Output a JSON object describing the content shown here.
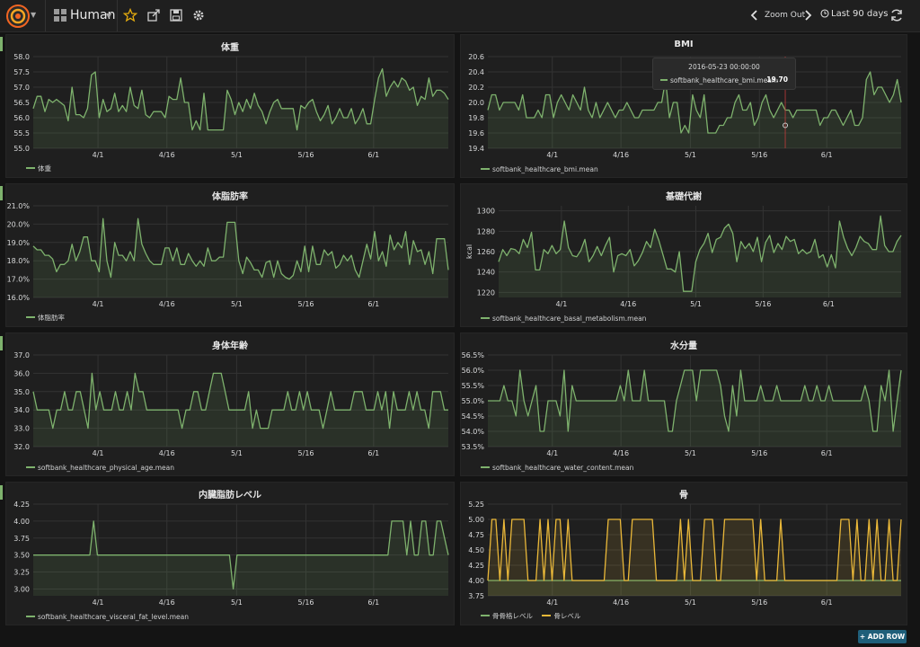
{
  "nav": {
    "dashboard_title": "Human",
    "zoom_out": "Zoom Out",
    "time_range": "Last 90 days",
    "add_row": "+ ADD ROW"
  },
  "tooltip": {
    "time": "2016-05-23 00:00:00",
    "series": "softbank_healthcare_bmi.mean:",
    "value": "19.70"
  },
  "colors": {
    "green": "#7eb26d",
    "yellow": "#eab839",
    "grid": "#333333",
    "axis_text": "#d8d9da"
  },
  "x_ticks": [
    "4/1",
    "4/16",
    "5/1",
    "5/16",
    "6/1"
  ],
  "chart_data": [
    {
      "id": "weight",
      "type": "line",
      "title": "体重",
      "ylabel": "",
      "ylim": [
        55.0,
        58.0
      ],
      "ystep": 0.5,
      "yfmt": 1,
      "ysuffix": "",
      "series": [
        {
          "name": "体重",
          "color": "#7eb26d",
          "values": [
            56.3,
            56.7,
            56.7,
            56.2,
            56.6,
            56.5,
            56.6,
            56.5,
            56.4,
            55.9,
            57.0,
            56.1,
            56.1,
            56.0,
            56.3,
            57.4,
            57.5,
            56.0,
            56.6,
            56.2,
            56.3,
            56.8,
            56.2,
            56.4,
            56.2,
            57.0,
            56.4,
            56.3,
            56.9,
            56.1,
            56.0,
            56.2,
            56.2,
            56.2,
            56.0,
            56.7,
            56.6,
            56.6,
            57.3,
            56.5,
            56.5,
            55.6,
            55.9,
            55.6,
            56.8,
            55.6,
            55.6,
            55.6,
            55.6,
            55.6,
            56.9,
            56.6,
            56.1,
            56.5,
            56.2,
            56.6,
            56.3,
            56.8,
            56.4,
            56.2,
            55.8,
            56.2,
            56.5,
            56.6,
            56.3,
            56.3,
            56.3,
            56.3,
            55.6,
            56.4,
            56.3,
            56.5,
            56.6,
            56.2,
            55.9,
            56.1,
            56.4,
            55.8,
            56.0,
            56.3,
            56.0,
            56.0,
            56.3,
            55.8,
            56.0,
            56.3,
            55.8,
            55.8,
            56.6,
            57.3,
            57.6,
            56.7,
            57.0,
            57.2,
            57.0,
            57.3,
            57.2,
            56.9,
            57.0,
            56.4,
            56.7,
            56.6,
            57.3,
            56.7,
            56.9,
            56.9,
            56.8,
            56.6
          ]
        }
      ]
    },
    {
      "id": "bmi",
      "type": "line",
      "title": "BMI",
      "ylabel": "",
      "ylim": [
        19.4,
        20.6
      ],
      "ystep": 0.2,
      "yfmt": 1,
      "ysuffix": "",
      "series": [
        {
          "name": "softbank_healthcare_bmi.mean",
          "color": "#7eb26d",
          "values": [
            19.9,
            20.1,
            20.1,
            19.9,
            20.0,
            20.0,
            20.0,
            20.0,
            19.9,
            20.1,
            19.8,
            19.8,
            19.8,
            19.9,
            19.8,
            20.1,
            20.1,
            19.8,
            20.0,
            20.1,
            20.0,
            19.9,
            20.1,
            20.0,
            19.9,
            20.2,
            19.9,
            19.8,
            20.0,
            19.8,
            19.9,
            20.0,
            19.9,
            19.8,
            19.9,
            19.9,
            20.0,
            19.9,
            19.8,
            19.8,
            19.9,
            19.9,
            19.9,
            19.9,
            20.0,
            20.0,
            20.3,
            19.8,
            20.0,
            20.0,
            19.6,
            19.7,
            19.6,
            20.1,
            19.9,
            19.8,
            20.1,
            19.6,
            19.6,
            19.6,
            19.7,
            19.7,
            19.8,
            19.8,
            20.0,
            20.1,
            19.9,
            19.9,
            20.0,
            19.7,
            19.8,
            20.0,
            20.1,
            19.9,
            19.8,
            19.9,
            20.0,
            19.9,
            19.9,
            19.8,
            19.9,
            19.9,
            19.9,
            19.9,
            19.9,
            19.9,
            19.7,
            19.8,
            19.8,
            19.9,
            19.9,
            19.8,
            19.7,
            19.8,
            19.9,
            19.7,
            19.7,
            19.8,
            20.3,
            20.4,
            20.1,
            20.2,
            20.2,
            20.1,
            20.0,
            20.1,
            20.3,
            20.0
          ]
        }
      ]
    },
    {
      "id": "fat",
      "type": "line",
      "title": "体脂肪率",
      "ylabel": "",
      "ylim": [
        16.0,
        21.0
      ],
      "ystep": 1.0,
      "yfmt": 1,
      "ysuffix": "%",
      "series": [
        {
          "name": "体脂肪率",
          "color": "#7eb26d",
          "values": [
            18.8,
            18.6,
            18.6,
            18.3,
            18.3,
            18.1,
            17.4,
            17.8,
            17.8,
            18.0,
            18.9,
            18.0,
            18.5,
            19.3,
            19.3,
            18.0,
            18.0,
            17.4,
            20.3,
            18.0,
            17.1,
            19.0,
            18.3,
            18.3,
            18.0,
            18.5,
            18.0,
            20.3,
            18.9,
            18.4,
            18.0,
            17.8,
            17.8,
            17.8,
            18.7,
            18.7,
            18.0,
            18.7,
            17.8,
            17.8,
            18.4,
            18.0,
            17.7,
            18.0,
            17.7,
            18.7,
            18.0,
            18.0,
            18.2,
            18.2,
            20.1,
            20.1,
            20.1,
            18.0,
            17.3,
            18.2,
            17.9,
            17.5,
            17.5,
            17.1,
            17.9,
            18.0,
            17.1,
            18.0,
            17.3,
            17.1,
            17.0,
            17.2,
            18.0,
            17.4,
            18.8,
            17.4,
            18.8,
            17.8,
            17.8,
            18.6,
            18.3,
            18.5,
            17.6,
            17.8,
            18.3,
            18.0,
            18.3,
            17.5,
            17.1,
            18.0,
            18.9,
            18.1,
            19.6,
            18.0,
            18.5,
            17.7,
            19.4,
            18.6,
            19.0,
            18.7,
            19.6,
            17.8,
            19.1,
            18.5,
            18.6,
            17.8,
            18.5,
            17.3,
            19.2,
            19.2,
            19.2,
            17.5
          ]
        }
      ]
    },
    {
      "id": "metabolism",
      "type": "line",
      "title": "基礎代謝",
      "ylabel": "kcal",
      "ylim": [
        1215,
        1305
      ],
      "yticks": [
        1220,
        1240,
        1260,
        1280,
        1300
      ],
      "yfmt": 0,
      "ysuffix": "",
      "series": [
        {
          "name": "softbank_healthcare_basal_metabolism.mean",
          "color": "#7eb26d",
          "values": [
            1250,
            1262,
            1256,
            1263,
            1262,
            1258,
            1272,
            1264,
            1279,
            1242,
            1242,
            1262,
            1258,
            1266,
            1258,
            1262,
            1290,
            1264,
            1256,
            1255,
            1261,
            1272,
            1250,
            1256,
            1265,
            1256,
            1266,
            1274,
            1240,
            1256,
            1258,
            1256,
            1262,
            1246,
            1251,
            1259,
            1270,
            1264,
            1282,
            1271,
            1257,
            1243,
            1243,
            1240,
            1260,
            1221,
            1221,
            1221,
            1250,
            1262,
            1268,
            1278,
            1259,
            1272,
            1274,
            1283,
            1287,
            1278,
            1250,
            1270,
            1263,
            1268,
            1260,
            1274,
            1250,
            1269,
            1276,
            1259,
            1268,
            1262,
            1275,
            1270,
            1272,
            1258,
            1262,
            1258,
            1260,
            1272,
            1254,
            1257,
            1245,
            1257,
            1244,
            1290,
            1274,
            1263,
            1256,
            1264,
            1275,
            1270,
            1268,
            1262,
            1262,
            1295,
            1266,
            1260,
            1260,
            1270,
            1276
          ]
        }
      ]
    },
    {
      "id": "physical_age",
      "type": "line",
      "title": "身体年齢",
      "ylabel": "",
      "ylim": [
        32.0,
        37.0
      ],
      "ystep": 1.0,
      "yfmt": 1,
      "ysuffix": "",
      "series": [
        {
          "name": "softbank_healthcare_physical_age.mean",
          "color": "#7eb26d",
          "values": [
            35,
            34,
            34,
            34,
            34,
            33,
            34,
            34,
            35,
            34,
            34,
            35,
            35,
            34,
            33,
            36,
            34,
            35,
            34,
            34,
            34,
            35,
            34,
            34,
            35,
            34,
            36,
            35,
            35,
            34,
            34,
            34,
            34,
            34,
            34,
            34,
            34,
            34,
            33,
            34,
            34,
            35,
            35,
            34,
            34,
            35,
            36,
            36,
            36,
            35,
            34,
            34,
            34,
            34,
            34,
            35,
            33,
            34,
            33,
            33,
            33,
            34,
            34,
            34,
            34,
            35,
            34,
            34,
            35,
            34,
            35,
            34,
            34,
            34,
            33,
            34,
            35,
            34,
            34,
            34,
            34,
            34,
            35,
            35,
            35,
            34,
            34,
            34,
            35,
            34,
            35,
            33,
            35,
            34,
            34,
            34,
            35,
            34,
            35,
            34,
            34,
            33,
            35,
            35,
            35,
            34,
            34
          ]
        }
      ]
    },
    {
      "id": "water",
      "type": "line",
      "title": "水分量",
      "ylabel": "",
      "ylim": [
        53.5,
        56.5
      ],
      "ystep": 0.5,
      "yfmt": 1,
      "ysuffix": "%",
      "series": [
        {
          "name": "softbank_healthcare_water_content.mean",
          "color": "#7eb26d",
          "values": [
            55.0,
            55.0,
            55.0,
            55.0,
            55.5,
            55.0,
            55.0,
            54.5,
            56.0,
            55.0,
            54.5,
            55.0,
            55.5,
            54.0,
            54.0,
            55.0,
            55.0,
            55.0,
            54.5,
            56.0,
            54.0,
            55.5,
            55.0,
            55.0,
            55.0,
            55.0,
            55.0,
            55.0,
            55.0,
            55.0,
            55.0,
            55.0,
            55.0,
            55.5,
            55.0,
            56.0,
            55.0,
            55.0,
            55.0,
            56.0,
            55.0,
            55.0,
            55.0,
            55.0,
            55.0,
            54.0,
            54.0,
            55.0,
            55.5,
            56.0,
            56.0,
            56.0,
            55.0,
            56.0,
            56.0,
            56.0,
            56.0,
            56.0,
            55.5,
            54.5,
            54.0,
            55.5,
            54.5,
            56.0,
            55.0,
            55.0,
            55.0,
            55.0,
            55.5,
            55.0,
            55.0,
            55.0,
            55.5,
            55.0,
            55.0,
            55.0,
            55.0,
            55.0,
            55.0,
            55.5,
            55.0,
            55.0,
            55.5,
            55.0,
            55.0,
            55.5,
            55.0,
            55.0,
            55.0,
            55.0,
            55.0,
            55.0,
            55.0,
            55.0,
            55.5,
            55.0,
            54.0,
            54.0,
            55.5,
            55.0,
            56.0,
            54.0,
            55.0,
            56.0
          ]
        }
      ]
    },
    {
      "id": "visceral",
      "type": "line",
      "title": "内臓脂肪レベル",
      "ylabel": "",
      "ylim": [
        2.9,
        4.25
      ],
      "yticks": [
        3.0,
        3.25,
        3.5,
        3.75,
        4.0,
        4.25
      ],
      "yfmt": 2,
      "ysuffix": "",
      "series": [
        {
          "name": "softbank_healthcare_visceral_fat_level.mean",
          "color": "#7eb26d",
          "values": [
            3.5,
            3.5,
            3.5,
            3.5,
            3.5,
            3.5,
            3.5,
            3.5,
            3.5,
            3.5,
            3.5,
            3.5,
            3.5,
            3.5,
            3.5,
            3.5,
            4.0,
            3.5,
            3.5,
            3.5,
            3.5,
            3.5,
            3.5,
            3.5,
            3.5,
            3.5,
            3.5,
            3.5,
            3.5,
            3.5,
            3.5,
            3.5,
            3.5,
            3.5,
            3.5,
            3.5,
            3.5,
            3.5,
            3.5,
            3.5,
            3.5,
            3.5,
            3.5,
            3.5,
            3.5,
            3.5,
            3.5,
            3.5,
            3.5,
            3.5,
            3.5,
            3.5,
            3.5,
            3.0,
            3.5,
            3.5,
            3.5,
            3.5,
            3.5,
            3.5,
            3.5,
            3.5,
            3.5,
            3.5,
            3.5,
            3.5,
            3.5,
            3.5,
            3.5,
            3.5,
            3.5,
            3.5,
            3.5,
            3.5,
            3.5,
            3.5,
            3.5,
            3.5,
            3.5,
            3.5,
            3.5,
            3.5,
            3.5,
            3.5,
            3.5,
            3.5,
            3.5,
            3.5,
            3.5,
            3.5,
            3.5,
            3.5,
            3.5,
            3.5,
            3.5,
            4.0,
            4.0,
            4.0,
            4.0,
            3.5,
            4.0,
            3.5,
            3.5,
            4.0,
            4.0,
            3.5,
            3.5,
            4.0,
            4.0,
            3.75,
            3.5
          ]
        }
      ]
    },
    {
      "id": "bone",
      "type": "line",
      "title": "骨",
      "ylabel": "",
      "ylim": [
        3.75,
        5.25
      ],
      "ystep": 0.25,
      "yfmt": 2,
      "ysuffix": "",
      "series": [
        {
          "name": "骨骨格レベル",
          "color": "#7eb26d",
          "values": [
            4,
            4,
            4,
            4,
            4,
            4,
            4,
            4,
            4,
            4,
            4,
            4,
            4,
            4,
            4,
            4,
            4,
            4,
            4,
            4,
            4,
            4,
            4,
            4,
            4,
            4,
            4,
            4,
            4,
            4,
            4,
            4,
            4,
            4,
            4,
            4,
            4,
            4,
            4,
            4,
            4,
            4,
            4,
            4,
            4,
            4,
            4,
            4,
            4,
            4,
            4,
            4,
            4,
            4,
            4,
            4,
            4,
            4,
            4,
            4,
            4,
            4,
            4,
            4,
            4,
            4,
            4,
            4,
            4,
            4,
            4,
            4,
            4,
            4,
            4,
            4,
            4,
            4,
            4,
            4,
            4,
            4,
            4,
            4,
            4,
            4,
            4,
            4,
            4,
            4,
            4,
            4,
            4,
            4,
            4,
            4,
            4,
            4,
            4,
            4,
            4,
            4,
            4,
            4
          ]
        },
        {
          "name": "骨レベル",
          "color": "#eab839",
          "values": [
            4,
            5,
            5,
            4,
            5,
            4,
            5,
            5,
            5,
            5,
            4,
            4,
            4,
            5,
            4,
            5,
            4,
            5,
            5,
            4,
            5,
            4,
            4,
            4,
            4,
            4,
            4,
            4,
            4,
            4,
            5,
            5,
            5,
            5,
            4,
            4,
            5,
            5,
            5,
            5,
            5,
            5,
            4,
            4,
            4,
            4,
            4,
            4,
            5,
            4,
            5,
            4,
            4,
            4,
            5,
            5,
            5,
            4,
            4,
            5,
            5,
            5,
            5,
            5,
            5,
            5,
            5,
            4,
            5,
            4,
            4,
            4,
            4,
            5,
            4,
            4,
            4,
            4,
            4,
            4,
            4,
            4,
            4,
            4,
            4,
            4,
            4,
            4,
            5,
            5,
            5,
            4,
            5,
            4,
            4,
            5,
            4,
            5,
            4,
            4,
            5,
            4,
            4,
            5
          ]
        }
      ]
    }
  ]
}
